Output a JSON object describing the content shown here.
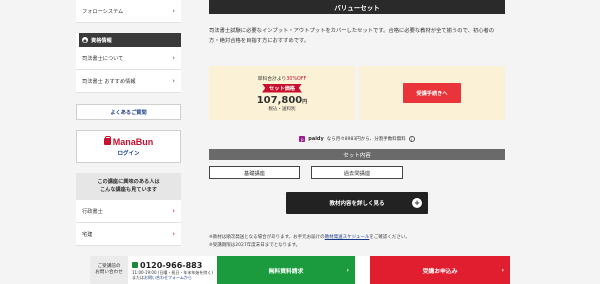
{
  "sidebar": {
    "follow_link": "フォローシステム",
    "section_head": "資格情報",
    "links": [
      "司法書士について",
      "司法書士 おすすめ情報"
    ],
    "faq": "よくあるご質問",
    "manabun_logo": "ManaBun",
    "manabun_login": "ログイン",
    "interest_title_line1": "この講座に興味のある人は",
    "interest_title_line2": "こんな講座も見ています",
    "related": [
      "行政書士",
      "宅建"
    ]
  },
  "main": {
    "value_bar": "バリューセット",
    "desc": "司法書士試験に必要なインプット・アウトプットをカバーしたセットです。合格に必要な教材が全て揃うので、初心者の方・絶対合格を目指す方におすすめです。",
    "price_note_prefix": "単科合計より",
    "price_note_red": "30%OFF",
    "set_badge": "セット価格",
    "price": "107,800",
    "price_unit": "円",
    "price_tax": "税込・送料別",
    "apply_pro": "受講手続きへ",
    "paidy_icon": "p",
    "paidy_name": "paidy",
    "paidy_text": "なら月々8983円から、分割手数料無料",
    "info_icon": "i",
    "set_content": "セット内容",
    "course_a": "基礎講座",
    "course_b": "過去問講座",
    "detail_btn": "教材内容を詳しく見る",
    "note1_pre": "※教材は順次発送となる場合があります。お手元お届けの",
    "note1_link": "教材発送スケジュール",
    "note1_post": "をご確認ください。",
    "note2": "※受講期限は2027年度末日までとなります。"
  },
  "bottom_bar": {
    "label_line1": "ご受講前の",
    "label_line2": "お問い合わせ",
    "phone": "0120-966-883",
    "hours": "11:00-19:00 (日曜・祝日・年末年始を除く)",
    "hours2_pre": "または",
    "hours2_link": "お問い合わせフォームから",
    "green_btn": "無料資料請求",
    "red_btn": "受講お申込み",
    "arrow": "›"
  },
  "colors": {
    "accent_red": "#e01e2f",
    "accent_green": "#1c9b3e",
    "price_bg": "#fbf1d6"
  }
}
